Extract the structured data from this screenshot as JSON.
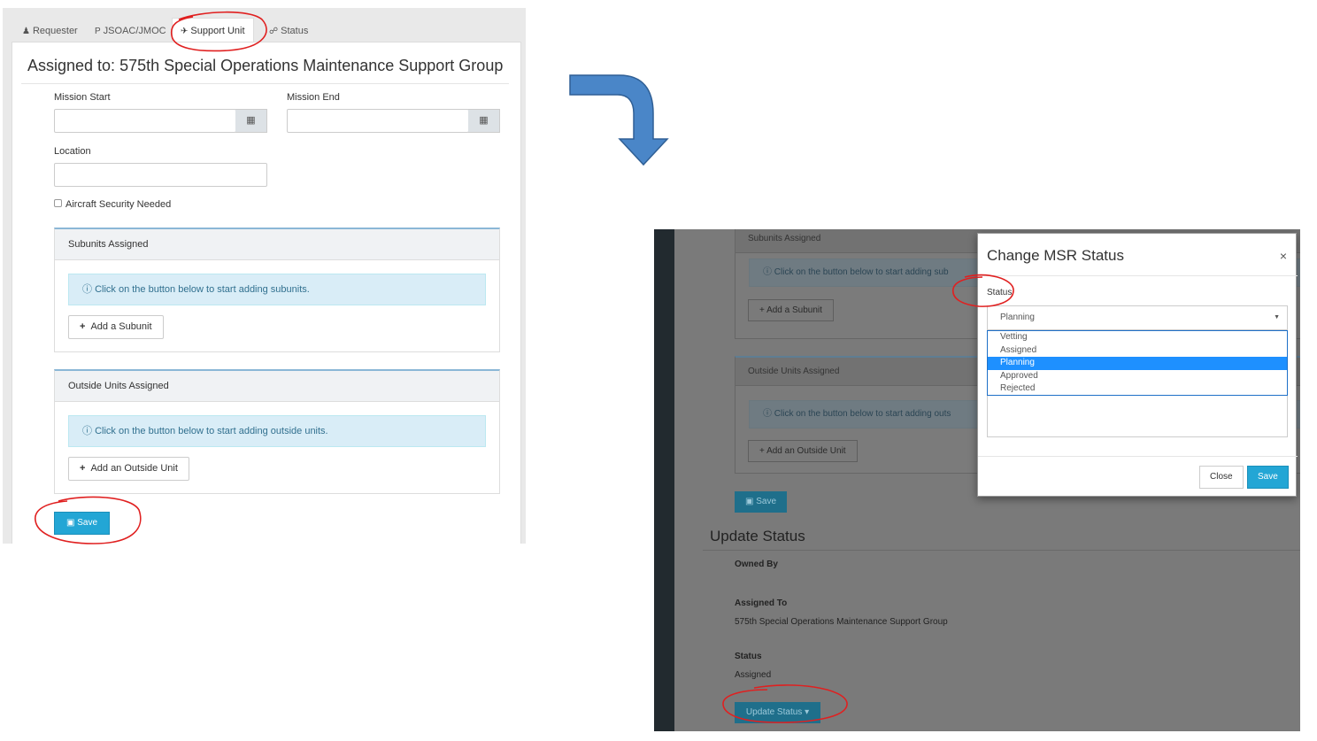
{
  "left": {
    "tabs": [
      {
        "icon": "user-icon",
        "glyph": "&#9823;",
        "label": "Requester"
      },
      {
        "icon": "plane-icon",
        "glyph": "P",
        "label": "JSOAC/JMOC"
      },
      {
        "icon": "plane-icon",
        "glyph": "✈",
        "label": "Support Unit"
      },
      {
        "icon": "comments-icon",
        "glyph": "☍",
        "label": "Status"
      }
    ],
    "title": "Assigned to: 575th Special Operations Maintenance Support Group",
    "mission_start_label": "Mission Start",
    "mission_end_label": "Mission End",
    "location_label": "Location",
    "aircraft_security_label": "Aircraft Security Needed",
    "subunits": {
      "header": "Subunits Assigned",
      "info": "Click on the button below to start adding subunits.",
      "button": "Add a Subunit"
    },
    "outside_units": {
      "header": "Outside Units Assigned",
      "info": "Click on the button below to start adding outside units.",
      "button": "Add an Outside Unit"
    },
    "save_label": "Save"
  },
  "right": {
    "subunits_header": "Subunits Assigned",
    "subunits_info": "Click on the button below to start adding sub",
    "add_subunit": "Add a Subunit",
    "outside_header": "Outside Units Assigned",
    "outside_info": "Click on the button below to start adding outs",
    "add_outside": "Add an Outside Unit",
    "save_label": "Save",
    "update_status_heading": "Update Status",
    "owned_by_label": "Owned By",
    "assigned_to_label": "Assigned To",
    "assigned_to_value": "575th Special Operations Maintenance Support Group",
    "status_label": "Status",
    "status_value": "Assigned",
    "update_status_button": "Update Status"
  },
  "modal": {
    "title": "Change MSR Status",
    "close_glyph": "×",
    "status_label": "Status",
    "selected": "Planning",
    "options": [
      "Vetting",
      "Assigned",
      "Planning",
      "Approved",
      "Rejected"
    ],
    "selected_index": 2,
    "close_button": "Close",
    "save_button": "Save"
  },
  "colors": {
    "accent": "#23a6d5",
    "annotation_red": "#e02020",
    "arrow_blue": "#4a86c8",
    "selected_option": "#1e90ff"
  }
}
